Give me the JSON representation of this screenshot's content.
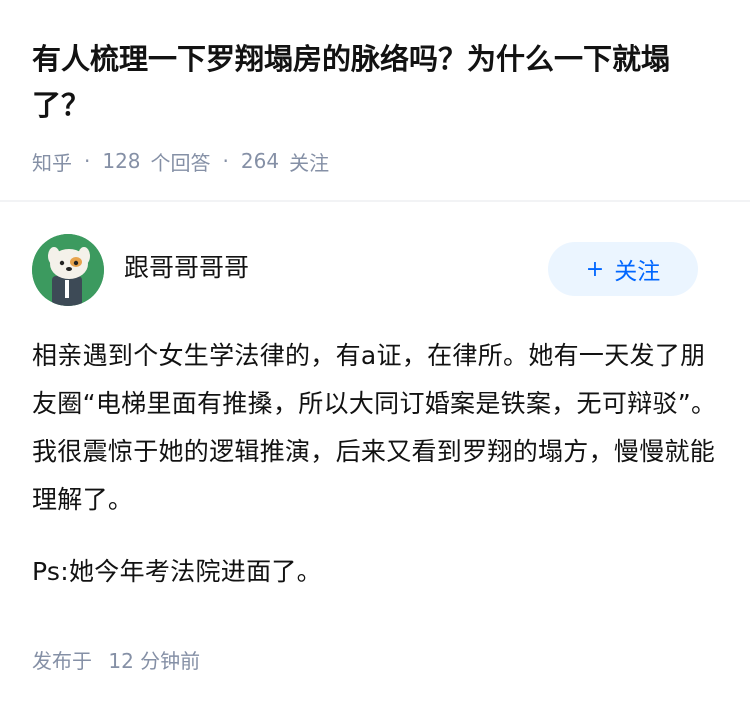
{
  "question": {
    "title": "有人梳理一下罗翔塌房的脉络吗？为什么一下就塌了？",
    "source": "知乎",
    "answer_count": "128",
    "answer_label": "个回答",
    "follow_count": "264",
    "follow_label": "关注"
  },
  "answer": {
    "author_name": "跟哥哥哥哥",
    "follow_button_plus": "+",
    "follow_button_label": "关注",
    "paragraphs": [
      "相亲遇到个女生学法律的，有a证，在律所。她有一天发了朋友圈“电梯里面有推搡，所以大同订婚案是铁案，无可辩驳”。我很震惊于她的逻辑推演，后来又看到罗翔的塌方，慢慢就能理解了。",
      "Ps:她今年考法院进面了。"
    ],
    "publish_prefix": "发布于",
    "publish_time": "12 分钟前"
  },
  "colors": {
    "text": "#121212",
    "meta": "#8590a6",
    "accent": "#0066ff",
    "button_bg": "#ebf5ff",
    "avatar_bg": "#3c9a5f"
  }
}
